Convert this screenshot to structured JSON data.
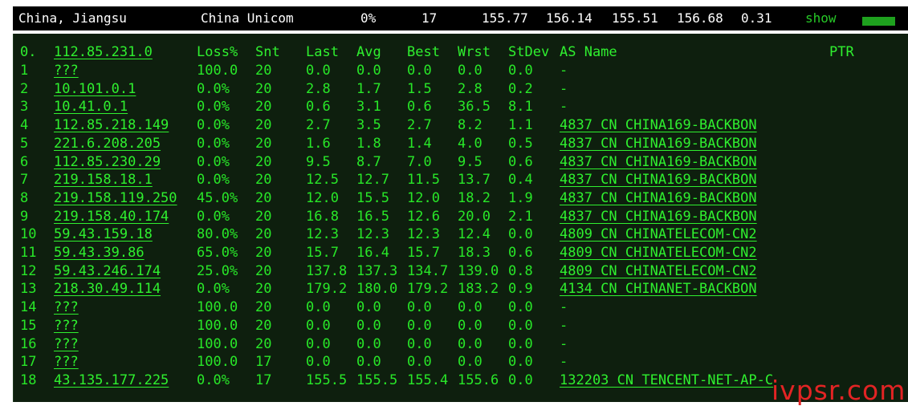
{
  "summary": {
    "location": "China, Jiangsu",
    "isp": "China Unicom",
    "loss": "0%",
    "sent": "17",
    "last": "155.77",
    "avg": "156.14",
    "best": "155.51",
    "worst": "156.68",
    "stdev": "0.31",
    "show_label": "show"
  },
  "header": {
    "hop": "0.",
    "host": "112.85.231.0",
    "loss": "Loss%",
    "snt": "Snt",
    "last": "Last",
    "avg": "Avg",
    "best": "Best",
    "wrst": "Wrst",
    "stdev": "StDev",
    "asname": "AS Name",
    "ptr": "PTR"
  },
  "rows": [
    {
      "hop": "1",
      "host": "???",
      "loss": "100.0",
      "snt": "20",
      "last": "0.0",
      "avg": "0.0",
      "best": "0.0",
      "wrst": "0.0",
      "stdev": "0.0",
      "asname": "-"
    },
    {
      "hop": "2",
      "host": "10.101.0.1",
      "loss": "0.0%",
      "snt": "20",
      "last": "2.8",
      "avg": "1.7",
      "best": "1.5",
      "wrst": "2.8",
      "stdev": "0.2",
      "asname": "-"
    },
    {
      "hop": "3",
      "host": "10.41.0.1",
      "loss": "0.0%",
      "snt": "20",
      "last": "0.6",
      "avg": "3.1",
      "best": "0.6",
      "wrst": "36.5",
      "stdev": "8.1",
      "asname": "-"
    },
    {
      "hop": "4",
      "host": "112.85.218.149",
      "loss": "0.0%",
      "snt": "20",
      "last": "2.7",
      "avg": "3.5",
      "best": "2.7",
      "wrst": "8.2",
      "stdev": "1.1",
      "asname": "4837  CN CHINA169-BACKBON"
    },
    {
      "hop": "5",
      "host": "221.6.208.205",
      "loss": "0.0%",
      "snt": "20",
      "last": "1.6",
      "avg": "1.8",
      "best": "1.4",
      "wrst": "4.0",
      "stdev": "0.5",
      "asname": "4837  CN CHINA169-BACKBON"
    },
    {
      "hop": "6",
      "host": "112.85.230.29",
      "loss": "0.0%",
      "snt": "20",
      "last": "9.5",
      "avg": "8.7",
      "best": "7.0",
      "wrst": "9.5",
      "stdev": "0.6",
      "asname": "4837  CN CHINA169-BACKBON"
    },
    {
      "hop": "7",
      "host": "219.158.18.1",
      "loss": "0.0%",
      "snt": "20",
      "last": "12.5",
      "avg": "12.7",
      "best": "11.5",
      "wrst": "13.7",
      "stdev": "0.4",
      "asname": "4837  CN CHINA169-BACKBON"
    },
    {
      "hop": "8",
      "host": "219.158.119.250",
      "loss": "45.0%",
      "snt": "20",
      "last": "12.0",
      "avg": "15.5",
      "best": "12.0",
      "wrst": "18.2",
      "stdev": "1.9",
      "asname": "4837  CN CHINA169-BACKBON"
    },
    {
      "hop": "9",
      "host": "219.158.40.174",
      "loss": "0.0%",
      "snt": "20",
      "last": "16.8",
      "avg": "16.5",
      "best": "12.6",
      "wrst": "20.0",
      "stdev": "2.1",
      "asname": "4837  CN CHINA169-BACKBON"
    },
    {
      "hop": "10",
      "host": "59.43.159.18",
      "loss": "80.0%",
      "snt": "20",
      "last": "12.3",
      "avg": "12.3",
      "best": "12.3",
      "wrst": "12.4",
      "stdev": "0.0",
      "asname": "4809  CN CHINATELECOM-CN2"
    },
    {
      "hop": "11",
      "host": "59.43.39.86",
      "loss": "65.0%",
      "snt": "20",
      "last": "15.7",
      "avg": "16.4",
      "best": "15.7",
      "wrst": "18.3",
      "stdev": "0.6",
      "asname": "4809  CN CHINATELECOM-CN2"
    },
    {
      "hop": "12",
      "host": "59.43.246.174",
      "loss": "25.0%",
      "snt": "20",
      "last": "137.8",
      "avg": "137.3",
      "best": "134.7",
      "wrst": "139.0",
      "stdev": "0.8",
      "asname": "4809  CN CHINATELECOM-CN2"
    },
    {
      "hop": "13",
      "host": "218.30.49.114",
      "loss": "0.0%",
      "snt": "20",
      "last": "179.2",
      "avg": "180.0",
      "best": "179.2",
      "wrst": "183.2",
      "stdev": "0.9",
      "asname": "4134  CN CHINANET-BACKBON"
    },
    {
      "hop": "14",
      "host": "???",
      "loss": "100.0",
      "snt": "20",
      "last": "0.0",
      "avg": "0.0",
      "best": "0.0",
      "wrst": "0.0",
      "stdev": "0.0",
      "asname": "-"
    },
    {
      "hop": "15",
      "host": "???",
      "loss": "100.0",
      "snt": "20",
      "last": "0.0",
      "avg": "0.0",
      "best": "0.0",
      "wrst": "0.0",
      "stdev": "0.0",
      "asname": "-"
    },
    {
      "hop": "16",
      "host": "???",
      "loss": "100.0",
      "snt": "20",
      "last": "0.0",
      "avg": "0.0",
      "best": "0.0",
      "wrst": "0.0",
      "stdev": "0.0",
      "asname": "-"
    },
    {
      "hop": "17",
      "host": "???",
      "loss": "100.0",
      "snt": "17",
      "last": "0.0",
      "avg": "0.0",
      "best": "0.0",
      "wrst": "0.0",
      "stdev": "0.0",
      "asname": "-"
    },
    {
      "hop": "18",
      "host": "43.135.177.225",
      "loss": "0.0%",
      "snt": "17",
      "last": "155.5",
      "avg": "155.5",
      "best": "155.4",
      "wrst": "155.6",
      "stdev": "0.0",
      "asname": "132203 CN TENCENT-NET-AP-C"
    }
  ],
  "watermark": "ivpsr.com",
  "colors": {
    "terminal_bg": "#0e1f0e",
    "text_green": "#28e728",
    "bar_green": "#1ea11e",
    "watermark_red": "#e22424"
  }
}
